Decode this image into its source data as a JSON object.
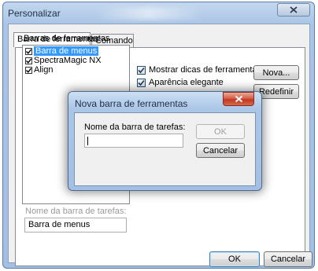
{
  "window": {
    "title": "Personalizar",
    "close_icon": "close-icon"
  },
  "tabs": [
    {
      "label": "Barra de ferramentas",
      "active": true
    },
    {
      "label": "Comando",
      "active": false
    }
  ],
  "toolbars": {
    "section_label": "Barras de ferramentas",
    "items": [
      {
        "label": "Barra de menus",
        "checked": true,
        "selected": true
      },
      {
        "label": "SpectraMagic NX",
        "checked": true,
        "selected": false
      },
      {
        "label": "Align",
        "checked": true,
        "selected": false
      }
    ]
  },
  "options": {
    "show_tips": {
      "label": "Mostrar dicas de ferramentas",
      "checked": true
    },
    "elegant": {
      "label": "Aparência elegante",
      "checked": true
    }
  },
  "side_buttons": {
    "new_label": "Nova...",
    "reset_label": "Redefinir"
  },
  "name_field": {
    "label": "Nome  da barra de tarefas:",
    "value": "Barra de menus"
  },
  "footer": {
    "ok_label": "OK",
    "cancel_label": "Cancelar"
  },
  "modal": {
    "title": "Nova barra de ferramentas",
    "field_label": "Nome  da barra de tarefas:",
    "field_value": "",
    "ok_label": "OK",
    "cancel_label": "Cancelar"
  },
  "colors": {
    "selection": "#3399ff",
    "modal_close": "#c2381f",
    "title_bar": "#a9c4e6"
  }
}
